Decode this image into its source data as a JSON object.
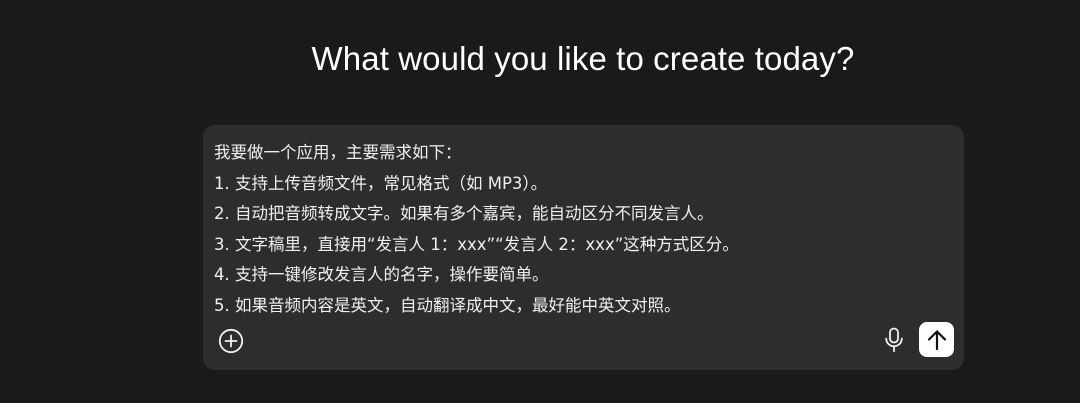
{
  "heading": "What would you like to create today?",
  "composer": {
    "lines": [
      "我要做一个应用，主要需求如下：",
      "1. 支持上传音频文件，常见格式（如 MP3）。",
      "2. 自动把音频转成文字。如果有多个嘉宾，能自动区分不同发言人。",
      "3. 文字稿里，直接用“发言人 1：xxx”“发言人 2：xxx”这种方式区分。",
      "4. 支持一键修改发言人的名字，操作要简单。",
      "5. 如果音频内容是英文，自动翻译成中文，最好能中英文对照。"
    ],
    "icons": {
      "add": "plus-circle-icon",
      "mic": "microphone-icon",
      "send": "arrow-up-icon"
    }
  },
  "colors": {
    "background": "#1a1a1a",
    "composer": "#2d2d2d",
    "text": "#f0f0f0",
    "send_button": "#ffffff"
  }
}
